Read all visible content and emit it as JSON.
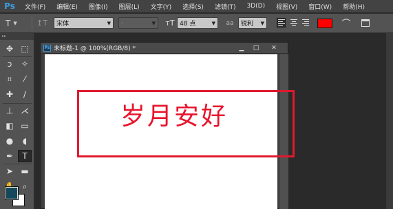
{
  "menubar": {
    "logo": "Ps",
    "items": [
      "文件(F)",
      "编辑(E)",
      "图像(I)",
      "图层(L)",
      "文字(Y)",
      "选择(S)",
      "滤镜(T)",
      "3D(D)",
      "视图(V)",
      "窗口(W)",
      "帮助(H)"
    ]
  },
  "options": {
    "tool_icon": "T",
    "font_family": "宋体",
    "font_style": "-",
    "font_size": "48 点",
    "antialias_icon": "aa",
    "antialias": "锐利",
    "text_color": "#ff0000"
  },
  "tools": [
    {
      "icon": "move-icon",
      "glyph": "✥"
    },
    {
      "icon": "marquee-icon",
      "glyph": "⬚"
    },
    {
      "icon": "lasso-icon",
      "glyph": "ↄ"
    },
    {
      "icon": "magic-wand-icon",
      "glyph": "✧"
    },
    {
      "icon": "crop-icon",
      "glyph": "⌗"
    },
    {
      "icon": "eyedropper-icon",
      "glyph": "⁄"
    },
    {
      "icon": "healing-icon",
      "glyph": "✚"
    },
    {
      "icon": "brush-icon",
      "glyph": "∕"
    },
    {
      "icon": "stamp-icon",
      "glyph": "⊥"
    },
    {
      "icon": "history-brush-icon",
      "glyph": "⋌"
    },
    {
      "icon": "eraser-icon",
      "glyph": "◧"
    },
    {
      "icon": "gradient-icon",
      "glyph": "▭"
    },
    {
      "icon": "blur-icon",
      "glyph": "●"
    },
    {
      "icon": "dodge-icon",
      "glyph": "◖"
    },
    {
      "icon": "pen-icon",
      "glyph": "✒"
    },
    {
      "icon": "type-icon",
      "glyph": "T"
    },
    {
      "icon": "path-select-icon",
      "glyph": "➤"
    },
    {
      "icon": "shape-icon",
      "glyph": "▬"
    },
    {
      "icon": "hand-icon",
      "glyph": "✋"
    },
    {
      "icon": "zoom-icon",
      "glyph": "⌕"
    }
  ],
  "swatches": {
    "foreground": "#14485a",
    "background": "#ffffff"
  },
  "document": {
    "title": "未标题-1 @ 100%(RGB/8) *",
    "ps_icon": "Ps",
    "btn_minimize": "▁",
    "btn_maximize": "□",
    "btn_close": "✕"
  },
  "canvas": {
    "text": "岁月安好",
    "text_color": "#e8142c"
  }
}
